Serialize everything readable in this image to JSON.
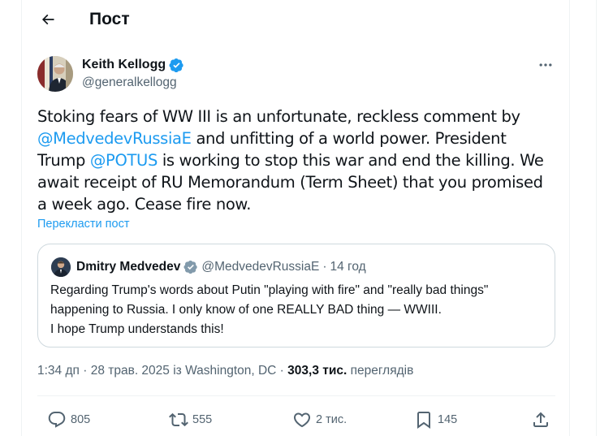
{
  "header": {
    "title": "Пост"
  },
  "tweet": {
    "author_name": "Keith Kellogg",
    "author_handle": "@generalkellogg",
    "text_parts": [
      "Stoking fears of WW III is an unfortunate, reckless comment by ",
      "@MedvedevRussiaE",
      " and unfitting of a world power. President Trump ",
      "@POTUS",
      " is working to stop this war and end the killing. We await receipt of RU Memorandum (Term Sheet) that you promised a week ago. Cease fire now."
    ],
    "translate_label": "Перекласти пост"
  },
  "quote": {
    "author_name": "Dmitry Medvedev",
    "author_handle": "@MedvedevRussiaE",
    "separator": "·",
    "time": "14 год",
    "text": "Regarding Trump's words about Putin \"playing with fire\" and \"really bad things\" happening to Russia. I only know of one REALLY BAD thing — WWIII.\nI hope Trump understands this!"
  },
  "meta": {
    "time": "1:34 дп",
    "sep1": " · ",
    "date": "28 трав. 2025",
    "location": " із Washington, DC",
    "sep2": " · ",
    "views_count": "303,3 тис.",
    "views_label": " переглядів"
  },
  "actions": {
    "replies": "805",
    "reposts": "555",
    "likes": "2 тис.",
    "bookmarks": "145"
  },
  "colors": {
    "accent": "#1d9bf0",
    "verified_blue": "#1d9bf0",
    "verified_gray": "#829aab",
    "secondary_text": "#536471"
  },
  "icons": [
    "back-arrow-icon",
    "verified-badge-icon",
    "more-icon",
    "reply-icon",
    "repost-icon",
    "like-icon",
    "bookmark-icon",
    "share-icon"
  ]
}
